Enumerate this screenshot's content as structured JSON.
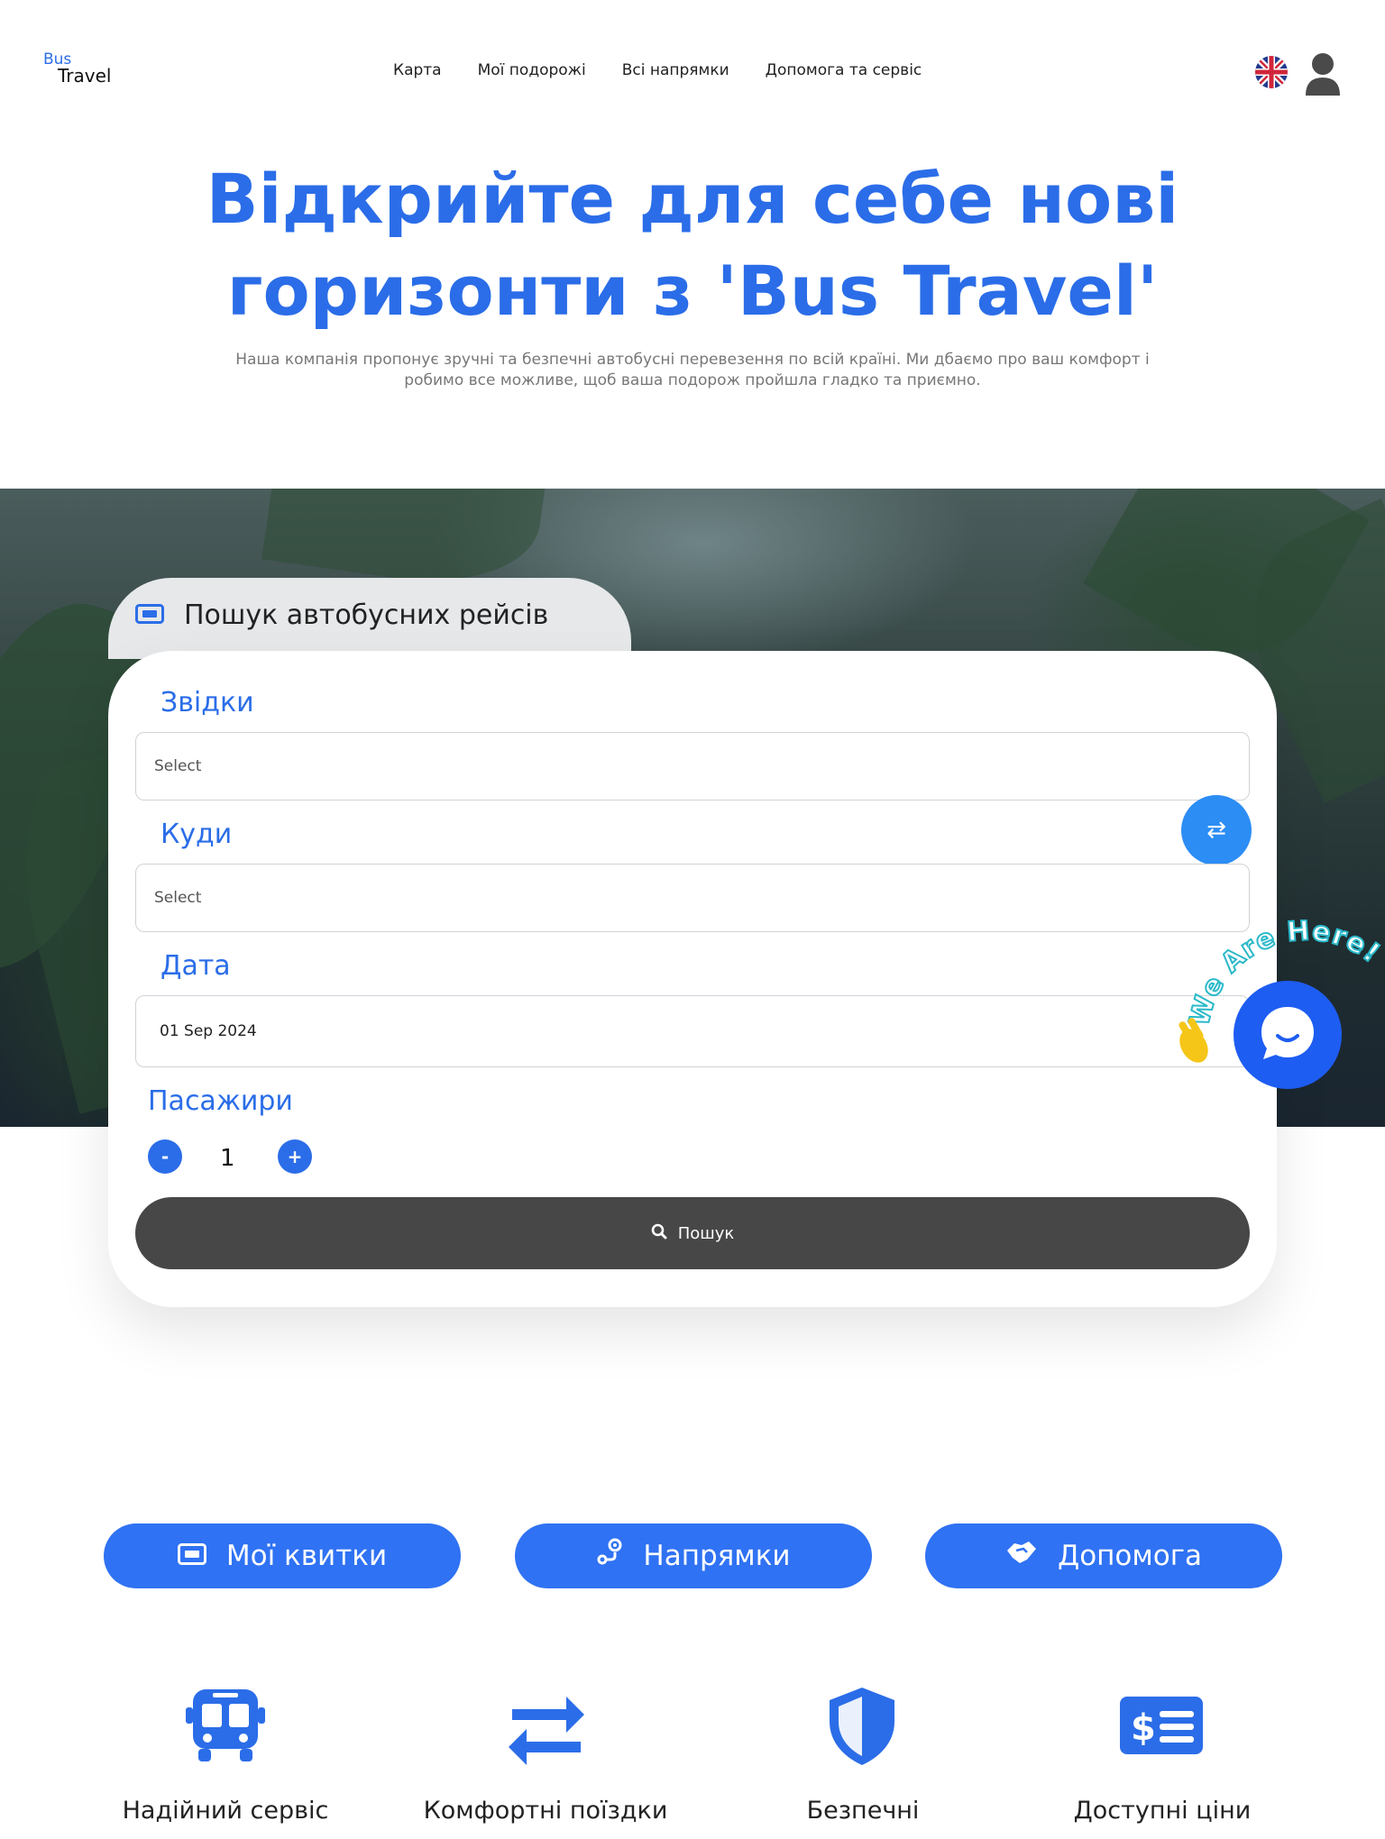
{
  "header": {
    "logo_top": "Bus",
    "logo_bottom": "Travel",
    "nav": [
      "Карта",
      "Мої подорожі",
      "Всі напрямки",
      "Допомога та сервіс"
    ],
    "language_icon": "uk-flag-icon",
    "account_icon": "user-icon"
  },
  "hero": {
    "title_line1": "Відкрийте для себе нові",
    "title_line2": "горизонти з 'Bus Travel'",
    "subtitle_line1": "Наша компанія пропонує зручні та безпечні автобусні перевезення по всій країні. Ми дбаємо про ваш комфорт і",
    "subtitle_line2": "робимо все можливе, щоб ваша подорож пройшла гладко та приємно."
  },
  "search": {
    "tab_title": "Пошук автобусних рейсів",
    "from_label": "Звідки",
    "from_value": "Select",
    "to_label": "Куди",
    "to_value": "Select",
    "date_label": "Дата",
    "date_value": "01 Sep 2024",
    "passengers_label": "Пасажири",
    "passengers_count": "1",
    "minus": "-",
    "plus": "+",
    "swap_symbol": "⇄",
    "search_button": "Пошук"
  },
  "chat": {
    "badge_text": "We Are Here!"
  },
  "quick_links": [
    {
      "label": "Мої квитки",
      "icon": "ticket-icon"
    },
    {
      "label": "Напрямки",
      "icon": "route-icon"
    },
    {
      "label": "Допомога",
      "icon": "handshake-icon"
    }
  ],
  "features": [
    {
      "label": "Надійний сервіс",
      "icon": "bus-icon"
    },
    {
      "label": "Комфортні поїздки",
      "icon": "exchange-icon"
    },
    {
      "label": "Безпечні",
      "icon": "shield-icon"
    },
    {
      "label": "Доступні ціни",
      "icon": "money-icon"
    }
  ],
  "colors": {
    "brand_blue": "#2b6de8",
    "pill_blue": "#2f72f3",
    "search_button": "#474747",
    "chat_blue": "#1e5df2"
  }
}
